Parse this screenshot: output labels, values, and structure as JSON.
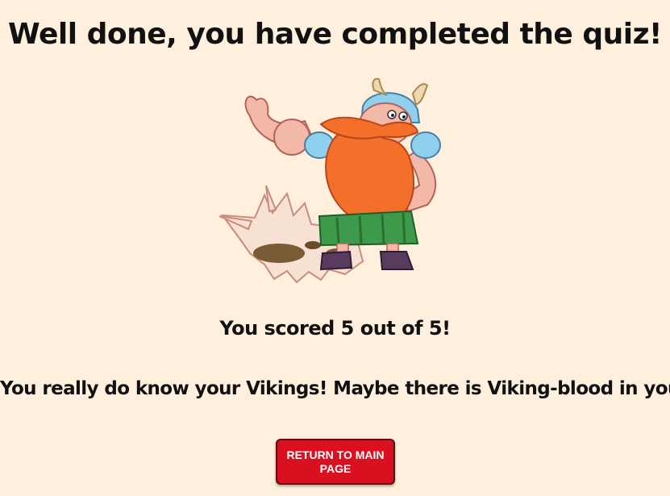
{
  "page": {
    "title": "Well done, you have completed the quiz!",
    "score_text": "You scored 5 out of 5!",
    "message": "You really do know your Vikings! Maybe there is Viking-blood in you?",
    "return_button_label": "RETURN TO MAIN PAGE"
  },
  "colors": {
    "background": "#fff0de",
    "button": "#d8101f",
    "button_text": "#ffffff"
  },
  "illustration": {
    "name": "viking-cartoon-illustration"
  }
}
